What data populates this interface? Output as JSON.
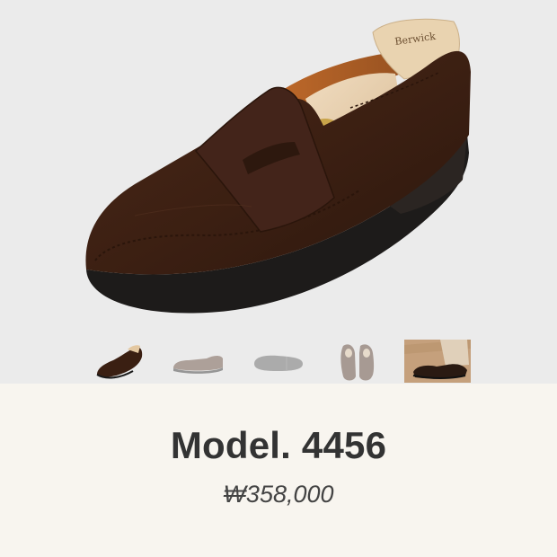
{
  "product": {
    "model": "Model. 4456",
    "price": "₩358,000"
  },
  "gallery": {
    "main_image": "brown-suede-penny-loafer-with-shoe-tree",
    "thumbnails": [
      {
        "name": "loafer-angle-view",
        "selected": true
      },
      {
        "name": "loafer-side-view",
        "selected": false
      },
      {
        "name": "loafer-sole-view",
        "selected": false
      },
      {
        "name": "loafer-pair-top-view",
        "selected": false
      },
      {
        "name": "loafer-worn-lifestyle",
        "selected": false
      }
    ]
  },
  "colors": {
    "gallery_bg": "#ebebeb",
    "info_bg": "#f8f5ef",
    "suede": "#3e2114",
    "text": "#333333"
  }
}
